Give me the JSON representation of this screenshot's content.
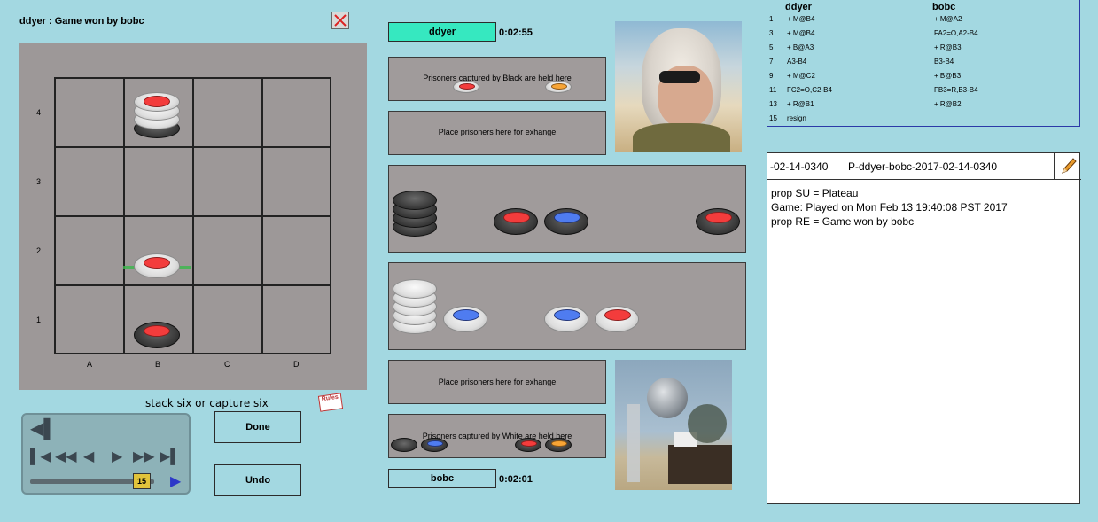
{
  "header": {
    "title": "ddyer : Game won by bobc"
  },
  "board": {
    "ranks": [
      "4",
      "3",
      "2",
      "1"
    ],
    "files": [
      "A",
      "B",
      "C",
      "D"
    ]
  },
  "status_text": "stack six or capture six",
  "rules_icon_text": "Rules",
  "players": {
    "top": {
      "name": "ddyer",
      "clock": "0:02:55",
      "color": "#36e8c0"
    },
    "bottom": {
      "name": "bobc",
      "clock": "0:02:01",
      "color": "#a3d8e1"
    }
  },
  "areas": {
    "captured_black": "Prisoners captured by  Black are held here",
    "exchange_top": "Place prisoners here for exhange",
    "exchange_bottom": "Place prisoners here for exhange",
    "captured_white": "Prisoners captured by  White are held here"
  },
  "buttons": {
    "done": "Done",
    "undo": "Undo"
  },
  "replay": {
    "slider_value": "15"
  },
  "moves": {
    "headers": [
      "ddyer",
      "bobc"
    ],
    "rows": [
      {
        "num": "1",
        "a": "+ M@B4",
        "b": "+ M@A2"
      },
      {
        "num": "3",
        "a": "+ M@B4",
        "b": "FA2=O,A2-B4"
      },
      {
        "num": "5",
        "a": "+ B@A3",
        "b": "+ R@B3"
      },
      {
        "num": "7",
        "a": "A3-B4",
        "b": "B3-B4"
      },
      {
        "num": "9",
        "a": "+ M@C2",
        "b": "+ B@B3"
      },
      {
        "num": "11",
        "a": "FC2=O,C2-B4",
        "b": "FB3=R,B3-B4"
      },
      {
        "num": "13",
        "a": "+ R@B1",
        "b": "+ R@B2"
      },
      {
        "num": "15",
        "a": "resign",
        "b": ""
      }
    ]
  },
  "game_info": {
    "date_field": "-02-14-0340",
    "name_field": "P-ddyer-bobc-2017-02-14-0340",
    "lines": [
      "prop SU = Plateau",
      "Game: Played on Mon Feb 13 19:40:08 PST 2017",
      "prop RE = Game won by bobc"
    ]
  },
  "colors": {
    "background": "#a3d8e1",
    "board": "#9d9898",
    "red": "#f33c3c",
    "blue": "#4f7cf0",
    "orange": "#f7a435"
  }
}
